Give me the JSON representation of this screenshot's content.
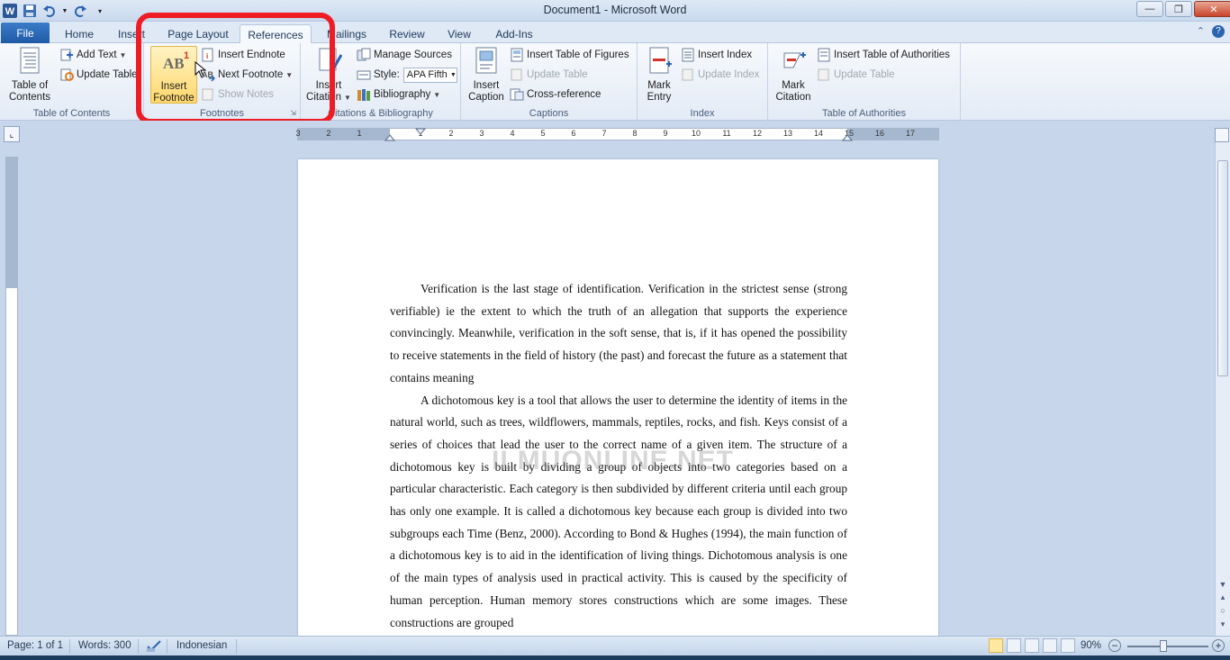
{
  "window": {
    "title": "Document1 - Microsoft Word",
    "app_icon": "W"
  },
  "tabs": [
    "File",
    "Home",
    "Insert",
    "Page Layout",
    "References",
    "Mailings",
    "Review",
    "View",
    "Add-Ins"
  ],
  "active_tab": "References",
  "ribbon": {
    "toc": {
      "table_of_contents": "Table of\nContents",
      "add_text": "Add Text",
      "update_table": "Update Table",
      "group_label": "Table of Contents"
    },
    "footnotes": {
      "insert_footnote_line1": "Insert",
      "insert_footnote_line2": "Footnote",
      "insert_endnote": "Insert Endnote",
      "next_footnote": "Next Footnote",
      "show_notes": "Show Notes",
      "group_label": "Footnotes",
      "icon_text": "AB",
      "icon_sup": "1"
    },
    "citations": {
      "insert_citation_line1": "Insert",
      "insert_citation_line2": "Citation",
      "manage_sources": "Manage Sources",
      "style_label": "Style:",
      "style_value": "APA Fifth",
      "bibliography": "Bibliography",
      "group_label": "Citations & Bibliography"
    },
    "captions": {
      "insert_caption_line1": "Insert",
      "insert_caption_line2": "Caption",
      "insert_table_of_figures": "Insert Table of Figures",
      "update_table": "Update Table",
      "cross_reference": "Cross-reference",
      "group_label": "Captions"
    },
    "index": {
      "mark_entry_line1": "Mark",
      "mark_entry_line2": "Entry",
      "insert_index": "Insert Index",
      "update_index": "Update Index",
      "group_label": "Index"
    },
    "authorities": {
      "mark_citation_line1": "Mark",
      "mark_citation_line2": "Citation",
      "insert_table_of_authorities": "Insert Table of Authorities",
      "update_table": "Update Table",
      "group_label": "Table of Authorities"
    }
  },
  "document": {
    "paragraphs": [
      "Verification is the last stage of identification. Verification in the strictest sense (strong verifiable) ie the extent to which the truth of an allegation that supports the experience convincingly. Meanwhile, verification in the soft sense, that is, if it has opened the possibility to receive statements in the field of history (the past) and forecast the future as a statement that contains meaning",
      "A dichotomous key is a tool that allows the user to determine the identity of items in the natural world, such as trees, wildflowers, mammals, reptiles, rocks, and fish. Keys consist of a series of choices that lead the user to the correct name of a given item. The structure of a dichotomous key is built by dividing a group of objects into two categories based on a particular characteristic. Each category is then subdivided by different criteria until each group has only one example. It is called a dichotomous key because each group is divided into two subgroups each Time (Benz, 2000). According to Bond & Hughes (1994), the main function of a dichotomous key is to aid in the identification of living things. Dichotomous analysis is one of the main types of analysis used in practical activity. This is caused by the specificity of human perception. Human memory stores constructions which are some images. These constructions are grouped"
    ],
    "watermark": "ILMUONLINE.NET"
  },
  "ruler_numbers": [
    "3",
    "2",
    "1",
    "1",
    "2",
    "3",
    "4",
    "5",
    "6",
    "7",
    "8",
    "9",
    "10",
    "11",
    "12",
    "13",
    "14",
    "15",
    "16",
    "17"
  ],
  "status": {
    "page": "Page: 1 of 1",
    "words": "Words: 300",
    "language": "Indonesian",
    "zoom": "90%"
  },
  "colors": {
    "annotation": "#ee1c25",
    "file_tab": "#2a68b6",
    "ribbon_bg": "#e3ebf6"
  }
}
